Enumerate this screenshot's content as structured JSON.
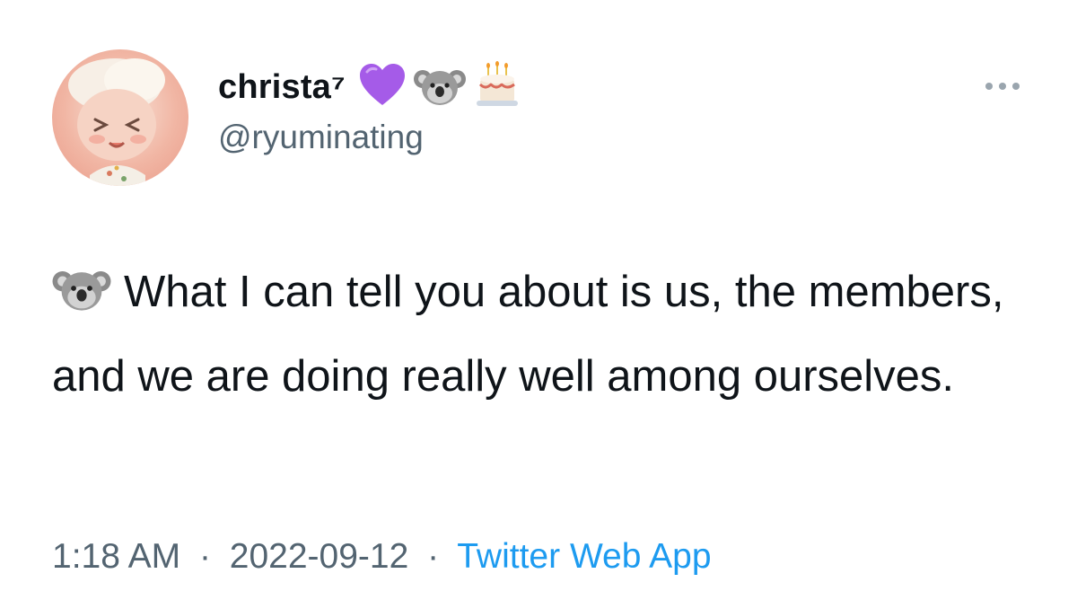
{
  "author": {
    "display_name": "christa⁷",
    "handle": "@ryuminating",
    "name_icons": [
      "purple-heart-icon",
      "koala-icon",
      "birthday-cake-icon"
    ]
  },
  "more_button": {
    "icon": "more-horizontal-icon"
  },
  "tweet": {
    "leading_icon": "koala-icon",
    "text": "What I can tell you about is us, the members, and we are doing really well among ourselves."
  },
  "meta": {
    "time": "1:18 AM",
    "separator": "·",
    "date": "2022-09-12",
    "source": "Twitter Web App"
  },
  "colors": {
    "text_primary": "#0f1419",
    "text_secondary": "#536471",
    "link": "#1d9bf0",
    "heart": "#a55be8"
  }
}
